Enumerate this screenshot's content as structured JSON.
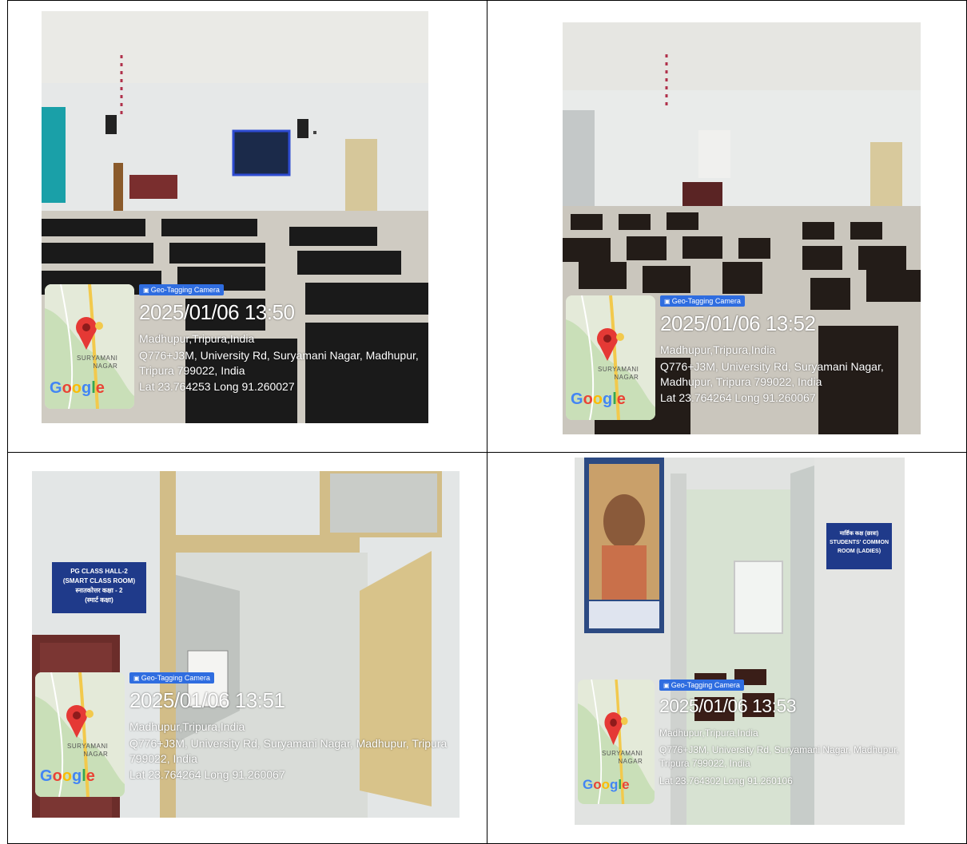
{
  "photos": [
    {
      "badge": "Geo-Tagging Camera",
      "timestamp": "2025/01/06 13:50",
      "place": "Madhupur,Tripura,India",
      "address": "Q776+J3M, University Rd, Suryamani Nagar, Madhupur, Tripura 799022, India",
      "coords": "Lat 23.764253 Long 91.260027",
      "map_label_1": "SURYAMANI",
      "map_label_2": "NAGAR",
      "google": "Google"
    },
    {
      "badge": "Geo-Tagging Camera",
      "timestamp": "2025/01/06 13:52",
      "place": "Madhupur,Tripura,India",
      "address": "Q776+J3M, University Rd, Suryamani Nagar, Madhupur, Tripura 799022, India",
      "coords": "Lat 23.764264 Long 91.260067",
      "map_label_1": "SURYAMANI",
      "map_label_2": "NAGAR",
      "google": "Google"
    },
    {
      "badge": "Geo-Tagging Camera",
      "timestamp": "2025/01/06 13:51",
      "place": "Madhupur,Tripura,India",
      "address": "Q776+J3M, University Rd, Suryamani Nagar, Madhupur, Tripura 799022, India",
      "coords": "Lat 23.764264 Long 91.260067",
      "map_label_1": "SURYAMANI",
      "map_label_2": "NAGAR",
      "google": "Google",
      "sign_1": "PG CLASS HALL-2",
      "sign_2": "(SMART CLASS ROOM)",
      "sign_3": "स्नातकोत्तर कक्षा - 2",
      "sign_4": "(स्मार्ट कक्षा)"
    },
    {
      "badge": "Geo-Tagging Camera",
      "timestamp": "2025/01/06 13:53",
      "place": "Madhupur,Tripura,India",
      "address": "Q776+J3M, University Rd, Suryamani Nagar, Madhupur, Tripura 799022, India",
      "coords": "Lat 23.764302 Long 91.260106",
      "map_label_1": "SURYAMANI",
      "map_label_2": "NAGAR",
      "google": "Google",
      "sign_1": "मार्ष्टिक कक्ष (छात्रा)",
      "sign_2": "STUDENTS' COMMON",
      "sign_3": "ROOM (LADIES)"
    }
  ],
  "colors": {
    "badge": "#2f6de0",
    "pin": "#e53935",
    "sign_blue": "#1f3a8a"
  }
}
